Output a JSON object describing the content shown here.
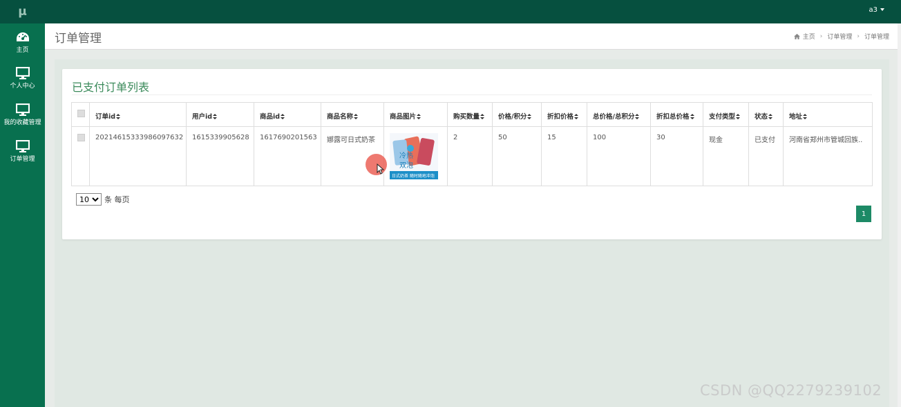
{
  "app": {
    "logo": "μ",
    "user": "a3"
  },
  "sidebar": {
    "items": [
      {
        "label": "主页",
        "icon": "dashboard-icon"
      },
      {
        "label": "个人中心",
        "icon": "monitor-icon"
      },
      {
        "label": "我的收藏管理",
        "icon": "monitor-icon"
      },
      {
        "label": "订单管理",
        "icon": "monitor-icon"
      }
    ]
  },
  "header": {
    "title": "订单管理",
    "breadcrumb": [
      "主页",
      "订单管理",
      "订单管理"
    ]
  },
  "panel": {
    "title": "已支付订单列表",
    "columns": [
      "订单id",
      "用户id",
      "商品id",
      "商品名称",
      "商品图片",
      "购买数量",
      "价格/积分",
      "折扣价格",
      "总价格/总积分",
      "折扣总价格",
      "支付类型",
      "状态",
      "地址"
    ],
    "rows": [
      {
        "order_id": "20214615333986097632",
        "user_id": "1615339905628",
        "product_id": "1617690201563",
        "product_name": "娜露可日式奶茶",
        "image_text_top": "冷热",
        "image_text_bottom": "双泡",
        "image_caption": "日式奶茶 随时随地冲泡",
        "quantity": "2",
        "price": "50",
        "discount_price": "15",
        "total_price": "100",
        "discount_total": "30",
        "pay_type": "现金",
        "status": "已支付",
        "address": "河南省郑州市管城回族.."
      }
    ]
  },
  "pagination": {
    "page_size": "10",
    "page_size_options": [
      "10"
    ],
    "page_size_suffix": "条 每页",
    "current_page": "1"
  },
  "watermark": "CSDN @QQ2279239102",
  "colors": {
    "topbar": "#06503f",
    "sidebar": "#08704f",
    "accent": "#1d8a66",
    "panel_title": "#3a8a5a"
  }
}
